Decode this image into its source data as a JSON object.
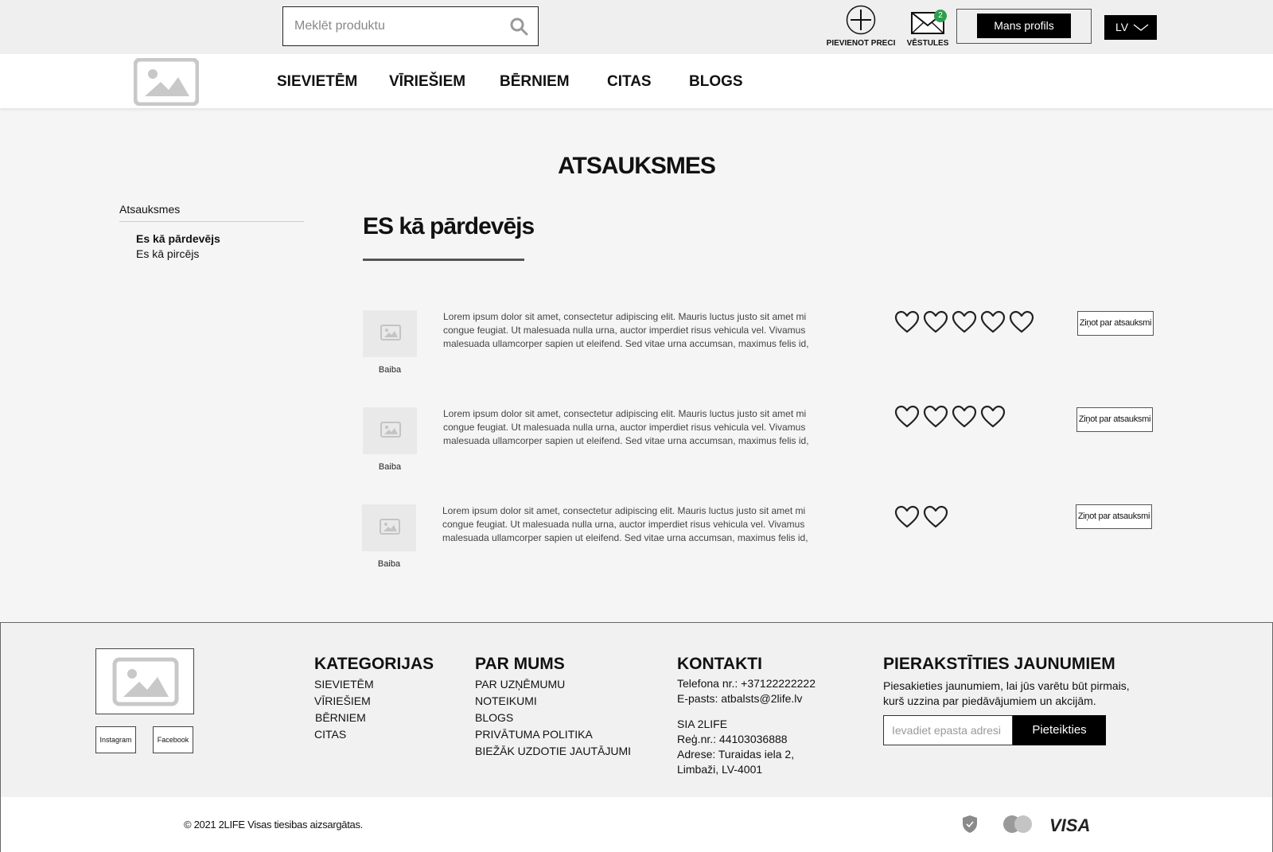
{
  "header": {
    "search_placeholder": "Meklēt produktu",
    "add_product_label": "PIEVIENOT PRECI",
    "messages_label": "VĒSTULES",
    "messages_count": "2",
    "profile_label": "Mans profils",
    "language": "LV"
  },
  "nav": {
    "items": [
      "SIEVIETĒM",
      "VĪRIEŠIEM",
      "BĒRNIEM",
      "CITAS",
      "BLOGS"
    ]
  },
  "page": {
    "title": "ATSAUKSMES"
  },
  "sidebar": {
    "heading": "Atsauksmes",
    "items": [
      "Es kā pārdevējs",
      "Es kā pircējs"
    ]
  },
  "section": {
    "title": "ES kā pārdevējs"
  },
  "reviews": [
    {
      "name": "Baiba",
      "text": "Lorem ipsum dolor sit amet, consectetur adipiscing elit. Mauris luctus justo sit amet mi congue feugiat. Ut malesuada nulla urna, auctor imperdiet risus vehicula vel. Vivamus malesuada ullamcorper sapien ut eleifend. Sed vitae urna accumsan, maximus felis id,",
      "rating": 5,
      "report_label": "Ziņot par atsauksmi"
    },
    {
      "name": "Baiba",
      "text": "Lorem ipsum dolor sit amet, consectetur adipiscing elit. Mauris luctus justo sit amet mi congue feugiat. Ut malesuada nulla urna, auctor imperdiet risus vehicula vel. Vivamus malesuada ullamcorper sapien ut eleifend. Sed vitae urna accumsan, maximus felis id,",
      "rating": 4,
      "report_label": "Ziņot par atsauksmi"
    },
    {
      "name": "Baiba",
      "text": "Lorem ipsum dolor sit amet, consectetur adipiscing elit. Mauris luctus justo sit amet mi congue feugiat. Ut malesuada nulla urna, auctor imperdiet risus vehicula vel. Vivamus malesuada ullamcorper sapien ut eleifend. Sed vitae urna accumsan, maximus felis id,",
      "rating": 2,
      "report_label": "Ziņot par atsauksmi"
    }
  ],
  "footer": {
    "social": [
      "Instagram",
      "Facebook"
    ],
    "categories": {
      "heading": "KATEGORIJAS",
      "links": [
        "SIEVIETĒM",
        "VĪRIEŠIEM",
        "BĒRNIEM",
        "CITAS"
      ]
    },
    "about": {
      "heading": "PAR MUMS",
      "links": [
        "PAR UZŅĒMUMU",
        "NOTEIKUMI",
        "BLOGS",
        "PRIVĀTUMA POLITIKA",
        "BIEŽĀK UZDOTIE JAUTĀJUMI"
      ]
    },
    "contacts": {
      "heading": "KONTAKTI",
      "phone": "Telefona nr.: +37122222222",
      "email": "E-pasts:  atbalsts@2life.lv",
      "company": "SIA 2LIFE",
      "reg": "Reģ.nr.: 44103036888",
      "address_1": "Adrese: Turaidas iela 2,",
      "address_2": "Limbaži, LV-4001"
    },
    "newsletter": {
      "heading": "PIERAKSTĪTIES JAUNUMIEM",
      "text_1": "Piesakieties jaunumiem, lai jūs varētu būt pirmais,",
      "text_2": "kurš uzzina par piedāvājumiem un akcijām.",
      "placeholder": "Ievadiet epasta adresi",
      "button": "Pieteikties"
    }
  },
  "bottom": {
    "copyright": "© 2021 2LIFE Visas tiesibas aizsargātas.",
    "payment_icons": [
      "shield-icon",
      "mastercard-icon",
      "visa-icon"
    ],
    "visa_text": "VISA"
  }
}
